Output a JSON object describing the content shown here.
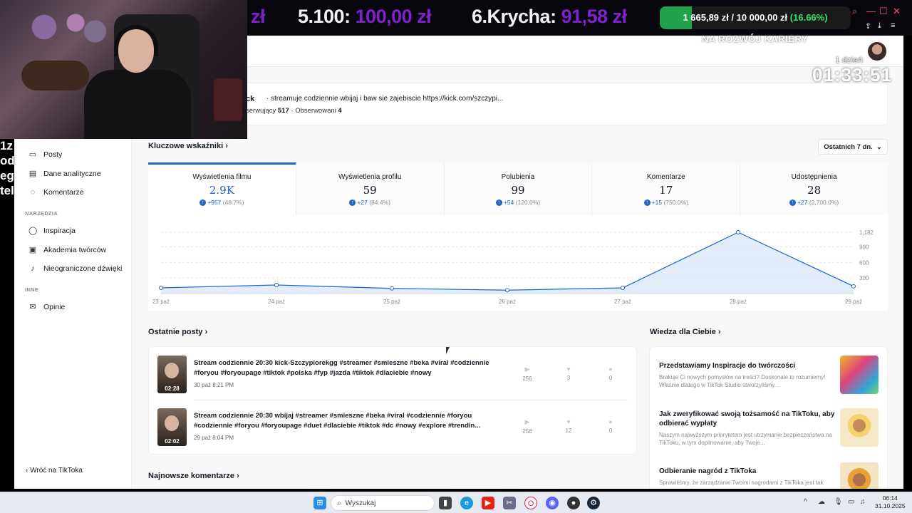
{
  "stream_bar": {
    "partial_amount": "zł",
    "donor5_name": "5.100:",
    "donor5_amount": "100,00 zł",
    "donor6_name": "6.Krycha:",
    "donor6_amount": "91,58 zł",
    "goal_amount": "1 665,89 zł / 10 000,00 zł",
    "goal_percent_text": "(16.66%)",
    "goal_progress": 0.1666
  },
  "overlay": {
    "career_text": "NA ROZWÓJ KARIERY",
    "timer_note": "1 dzień",
    "timer": "01:33:51",
    "left_lines": [
      "1z",
      "od",
      "eg",
      "tel"
    ]
  },
  "profile": {
    "name": "ck",
    "bio": "streamuje codziennie wbijaj i baw sie zajebiscie https://kick.com/szczypi...",
    "followers_label": "serwujący",
    "followers_value": "517",
    "following_label": "Obserwowani",
    "following_value": "4"
  },
  "sidebar": {
    "items": [
      {
        "label": "Posty",
        "icon": "posts-icon"
      },
      {
        "label": "Dane analityczne",
        "icon": "analytics-icon"
      },
      {
        "label": "Komentarze",
        "icon": "comments-icon"
      }
    ],
    "section_tools": "NARZĘDZIA",
    "tools": [
      {
        "label": "Inspiracja",
        "icon": "lightbulb-icon"
      },
      {
        "label": "Akademia twórców",
        "icon": "book-icon"
      },
      {
        "label": "Nieograniczone dźwięki",
        "icon": "music-note-icon"
      }
    ],
    "section_other": "INNE",
    "other": [
      {
        "label": "Opinie",
        "icon": "mail-icon"
      }
    ],
    "back_label": "Wróć na TikToka"
  },
  "metrics_section": {
    "title": "Kluczowe wskaźniki",
    "range_label": "Ostatnich 7 dn."
  },
  "metrics": [
    {
      "label": "Wyświetlenia filmu",
      "value": "2.9K",
      "delta": "+957",
      "pct": "(48.7%)"
    },
    {
      "label": "Wyświetlenia profilu",
      "value": "59",
      "delta": "+27",
      "pct": "(84.4%)"
    },
    {
      "label": "Polubienia",
      "value": "99",
      "delta": "+54",
      "pct": "(120.0%)"
    },
    {
      "label": "Komentarze",
      "value": "17",
      "delta": "+15",
      "pct": "(750.0%)"
    },
    {
      "label": "Udostępnienia",
      "value": "28",
      "delta": "+27",
      "pct": "(2,700.0%)"
    }
  ],
  "chart_data": {
    "type": "area",
    "title": "",
    "xlabel": "",
    "ylabel": "",
    "categories": [
      "23 paź",
      "24 paź",
      "25 paź",
      "26 paź",
      "27 paź",
      "28 paź",
      "29 paź"
    ],
    "series": [
      {
        "values": [
          110,
          165,
          100,
          65,
          110,
          1182,
          140
        ]
      }
    ],
    "y_ticks": [
      "1,182",
      "900",
      "600",
      "300"
    ],
    "y_tick_values": [
      1182,
      900,
      600,
      300
    ],
    "ylim": [
      0,
      1182
    ],
    "grid": true,
    "color": "#1b66c9",
    "fill": "#dbe9f8"
  },
  "posts_section": {
    "title": "Ostatnie posty"
  },
  "posts": [
    {
      "title": "Stream codziennie 20:30 kick-Szczypiorekgg #streamer #smieszne #beka #viral #codziennie #foryou #foryoupage #tiktok #polska #fyp #jazda #tiktok #dlaciebie #nowy",
      "date": "30 paź 8:21 PM",
      "duration": "02:28",
      "views": "256",
      "likes": "3",
      "comments": "0"
    },
    {
      "title": "Stream codziennie 20:30 wbijaj #streamer #smieszne #beka #viral #codziennie #foryou #codziennie #foryou #foryoupage #duet #dlaciebie #tiktok #dc #nowy #explore #trendin...",
      "date": "29 paź 8:04 PM",
      "duration": "02:02",
      "views": "256",
      "likes": "12",
      "comments": "0"
    }
  ],
  "comments_section": {
    "title": "Najnowsze komentarze"
  },
  "knowledge_section": {
    "title": "Wiedza dla Ciebie"
  },
  "knowledge": [
    {
      "title": "Przedstawiamy Inspiracje do twórczości",
      "desc": "Brakuje Ci nowych pomysłów na treści? Doskonale to rozumiemy! Właśnie dlatego w TikTok Studio stworzyliśmy..."
    },
    {
      "title": "Jak zweryfikować swoją tożsamość na TikToku, aby odbierać wypłaty",
      "desc": "Naszym najwyższym priorytetem jest utrzymanie bezpieczeństwa na TikToku, w tym dopilnowanie, aby Twoje..."
    },
    {
      "title": "Odbieranie nagród z TikToka",
      "desc": "Sprawiliśmy, że zarządzanie Twoimi nagrodami z TikToka jest tak"
    }
  ],
  "taskbar": {
    "search_placeholder": "Wyszukaj",
    "time": "06:14",
    "date": "31.10.2025"
  }
}
